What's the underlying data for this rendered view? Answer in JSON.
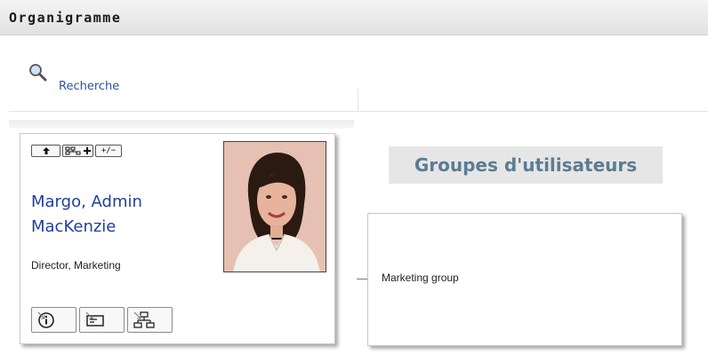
{
  "header": {
    "title": "Organigramme"
  },
  "search": {
    "label": "Recherche",
    "icon": "magnifier-icon"
  },
  "person_card": {
    "name_line1": "Margo, Admin",
    "name_line2": "MacKenzie",
    "role": "Director, Marketing",
    "toolbar": {
      "up_icon": "up-arrow-icon",
      "expand_icon": "expand-hierarchy-icon",
      "toggle_label": "+/−"
    },
    "actions": [
      {
        "icon": "info-icon"
      },
      {
        "icon": "email-icon"
      },
      {
        "icon": "org-chart-icon"
      }
    ]
  },
  "groups": {
    "title": "Groupes d'utilisateurs",
    "items": [
      {
        "label": "Marketing group"
      }
    ]
  },
  "colors": {
    "name_link": "#213f9c",
    "groups_title": "#5b7c93",
    "search_link": "#2b55a0"
  }
}
